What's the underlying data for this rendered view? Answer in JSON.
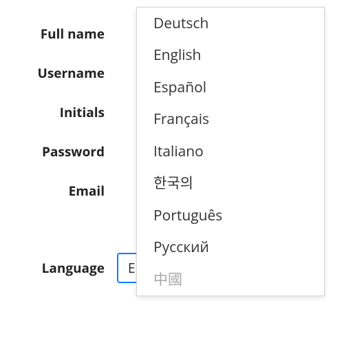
{
  "labels": {
    "full_name": "Full name",
    "username": "Username",
    "initials": "Initials",
    "password": "Password",
    "email": "Email",
    "language": "Language"
  },
  "language": {
    "selected": "English",
    "options": [
      "Deutsch",
      "English",
      "Español",
      "Français",
      "Italiano",
      "한국의",
      "Português",
      "Русский",
      "中國"
    ]
  }
}
